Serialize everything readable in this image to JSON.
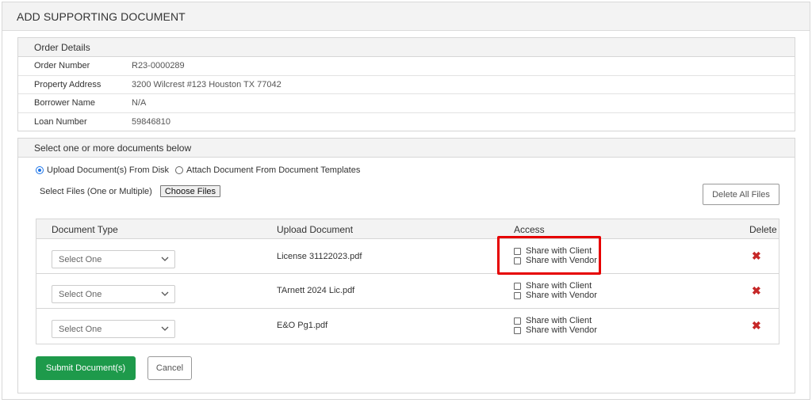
{
  "header": {
    "title": "ADD SUPPORTING DOCUMENT"
  },
  "order_details": {
    "heading": "Order Details",
    "rows": [
      {
        "label": "Order Number",
        "value": "R23-0000289"
      },
      {
        "label": "Property Address",
        "value": "3200 Wilcrest #123 Houston TX 77042"
      },
      {
        "label": "Borrower Name",
        "value": "N/A"
      },
      {
        "label": "Loan Number",
        "value": "59846810"
      }
    ]
  },
  "documents": {
    "heading": "Select one or more documents below",
    "radio_upload": "Upload Document(s) From Disk",
    "radio_attach": "Attach Document From Document Templates",
    "radio_selected": "upload",
    "select_files_label": "Select Files (One or Multiple)",
    "choose_files_label": "Choose Files",
    "delete_all_label": "Delete All Files",
    "columns": {
      "type": "Document Type",
      "upload": "Upload Document",
      "access": "Access",
      "delete": "Delete"
    },
    "rows": [
      {
        "type": "Select One",
        "file": "License 31122023.pdf",
        "share_client": "Share with Client",
        "share_vendor": "Share with Vendor"
      },
      {
        "type": "Select One",
        "file": "TArnett 2024 Lic.pdf",
        "share_client": "Share with Client",
        "share_vendor": "Share with Vendor"
      },
      {
        "type": "Select One",
        "file": "E&O Pg1.pdf",
        "share_client": "Share with Client",
        "share_vendor": "Share with Vendor"
      }
    ],
    "delete_icon": "close-x-icon",
    "submit_label": "Submit Document(s)",
    "cancel_label": "Cancel"
  },
  "colors": {
    "accent_green": "#1e9a4b",
    "delete_red": "#c62828",
    "highlight_red": "#e60000",
    "radio_blue": "#1a73e8"
  }
}
